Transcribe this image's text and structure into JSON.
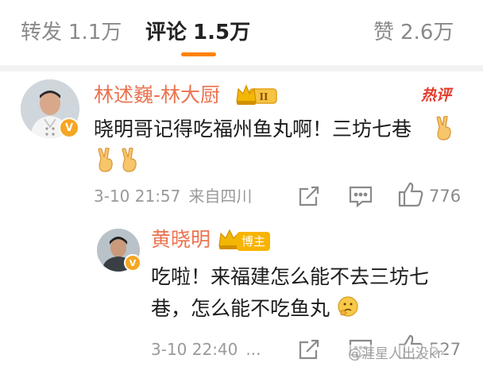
{
  "tabs": {
    "reposts": {
      "label": "转发",
      "count": "1.1万"
    },
    "comments": {
      "label": "评论",
      "count": "1.5万",
      "active": true
    },
    "likes": {
      "label": "赞",
      "count": "2.6万"
    },
    "accent_color": "#ff8200"
  },
  "comment": {
    "author": "林述巍-林大厨",
    "level_badge": "II",
    "hot_label": "热评",
    "text": "晓明哥记得吃福州鱼丸啊！三坊七巷",
    "emojis": [
      "victory-hand-emoji",
      "victory-hand-emoji",
      "victory-hand-emoji"
    ],
    "date": "3-10 21:57",
    "source": "来自四川",
    "like_count": "776",
    "name_color": "#eb7350"
  },
  "reply": {
    "author": "黄晓明",
    "role_badge": "博主",
    "text_line1": "吃啦！来福建怎么能不去三坊七",
    "text_line2": "巷，怎么能不吃鱼丸",
    "emoji": "thinking-face-emoji",
    "date": "3-10 22:40",
    "source": "...",
    "like_count": "527"
  },
  "watermark": "@涯星人出没kr"
}
